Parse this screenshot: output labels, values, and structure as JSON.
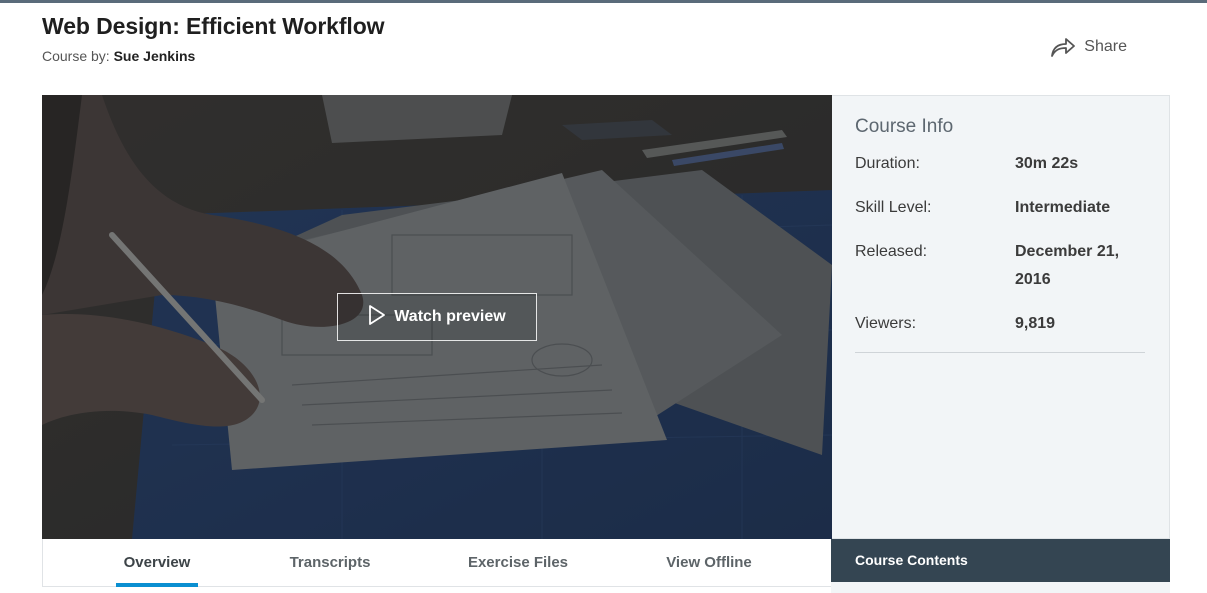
{
  "course": {
    "title": "Web Design: Efficient Workflow",
    "byline_prefix": "Course by:",
    "author": "Sue Jenkins"
  },
  "share": {
    "label": "Share",
    "icon": "share-arrow-icon"
  },
  "video": {
    "button_label": "Watch preview",
    "icon": "play-icon"
  },
  "course_info": {
    "title": "Course Info",
    "rows": [
      {
        "label": "Duration:",
        "value": "30m 22s"
      },
      {
        "label": "Skill Level:",
        "value": "Intermediate"
      },
      {
        "label": "Released:",
        "value": "December 21, 2016"
      },
      {
        "label": "Viewers:",
        "value": "9,819"
      }
    ]
  },
  "tabs": [
    {
      "label": "Overview",
      "active": true
    },
    {
      "label": "Transcripts",
      "active": false
    },
    {
      "label": "Exercise Files",
      "active": false
    },
    {
      "label": "View Offline",
      "active": false
    }
  ],
  "contents": {
    "label": "Course Contents"
  },
  "colors": {
    "accent": "#0a8fd1",
    "contents_bar": "#344552",
    "info_bg": "#f2f5f7"
  }
}
